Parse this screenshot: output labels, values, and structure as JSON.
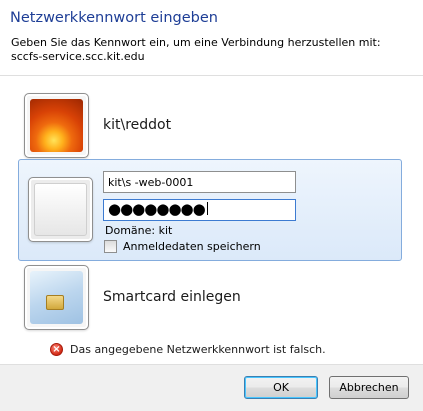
{
  "dialog": {
    "title": "Netzwerkkennwort eingeben",
    "subtitle_line1": "Geben Sie das Kennwort ein, um eine Verbindung herzustellen mit:",
    "subtitle_line2": "sccfs-service.scc.kit.edu"
  },
  "accounts": {
    "existing_user": "kit\\reddot",
    "username_value": "kit\\s  -web-0001",
    "password_mask": "●●●●●●●●",
    "domain_text": "Domäne: kit",
    "remember_label": "Anmeldedaten speichern",
    "remember_checked": false,
    "smartcard_label": "Smartcard einlegen"
  },
  "error": {
    "message": "Das angegebene Netzwerkkennwort ist falsch."
  },
  "buttons": {
    "ok": "OK",
    "cancel": "Abbrechen"
  },
  "colors": {
    "title": "#1e3e96",
    "selection_border": "#84acdd",
    "error_red": "#d12a16"
  }
}
